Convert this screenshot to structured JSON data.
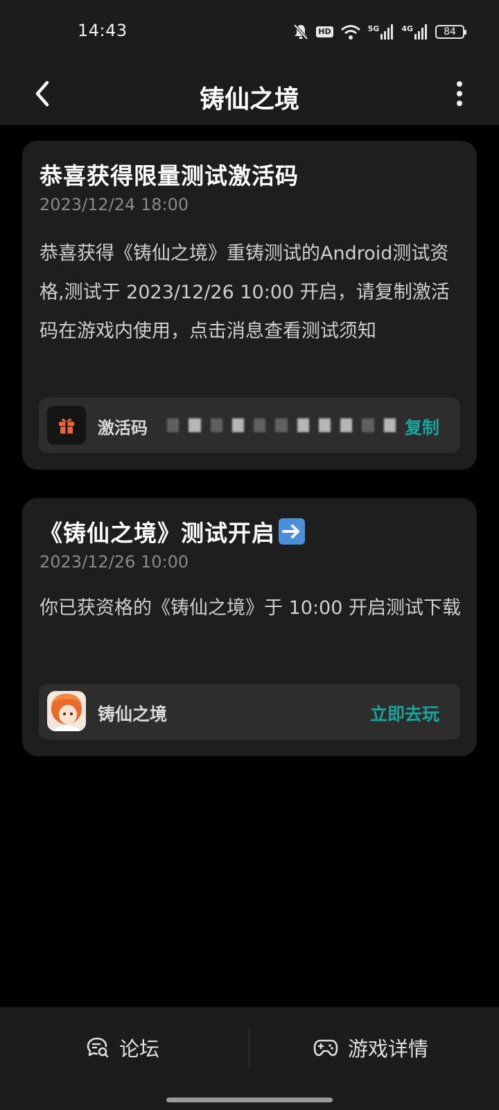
{
  "status_bar": {
    "time": "14:43",
    "hd_label": "HD",
    "net_1": "5G",
    "net_2": "4G",
    "battery": "84"
  },
  "header": {
    "title": "铸仙之境",
    "back_icon": "chevron-left-icon",
    "more_icon": "more-vertical-icon"
  },
  "messages": [
    {
      "title": "恭喜获得限量测试激活码",
      "date": "2023/12/24 18:00",
      "body": "恭喜获得《铸仙之境》重铸测试的Android测试资格,测试于 2023/12/26 10:00 开启，请复制激活码在游戏内使用，点击消息查看测试须知",
      "code_label": "激活码",
      "code_icon": "gift-icon",
      "copy_label": "复制"
    },
    {
      "title": "《铸仙之境》测试开启",
      "title_icon": "arrow-right-emoji-icon",
      "date": "2023/12/26 10:00",
      "body": "你已获资格的《铸仙之境》于 10:00 开启测试下载",
      "game_name": "铸仙之境",
      "play_label": "立即去玩"
    }
  ],
  "bottom_bar": {
    "forum_label": "论坛",
    "forum_icon": "chat-search-icon",
    "details_label": "游戏详情",
    "details_icon": "gamepad-icon"
  },
  "colors": {
    "accent": "#1aa39a",
    "card_bg": "#1e1e1e",
    "bar_bg": "#1c1c1c",
    "gift": "#e8673c"
  }
}
